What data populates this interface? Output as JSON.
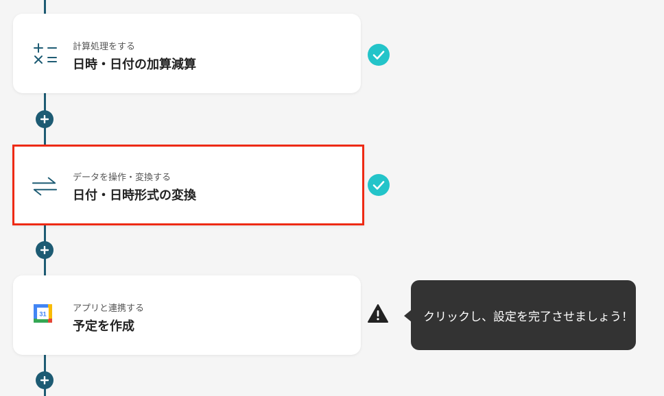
{
  "steps": [
    {
      "category": "計算処理をする",
      "title": "日時・日付の加算減算",
      "icon": "calculator-icon",
      "status": "complete"
    },
    {
      "category": "データを操作・変換する",
      "title": "日付・日時形式の変換",
      "icon": "exchange-arrows-icon",
      "status": "complete"
    },
    {
      "category": "アプリと連携する",
      "title": "予定を作成",
      "icon": "google-calendar-icon",
      "calendar_day": "31",
      "status": "warning"
    }
  ],
  "tooltip": {
    "text": "クリックし、設定を完了させましょう！"
  },
  "colors": {
    "flow": "#1d5b73",
    "check": "#23c4c9",
    "selected_border": "#ee2a14",
    "tooltip_bg": "#333333"
  }
}
